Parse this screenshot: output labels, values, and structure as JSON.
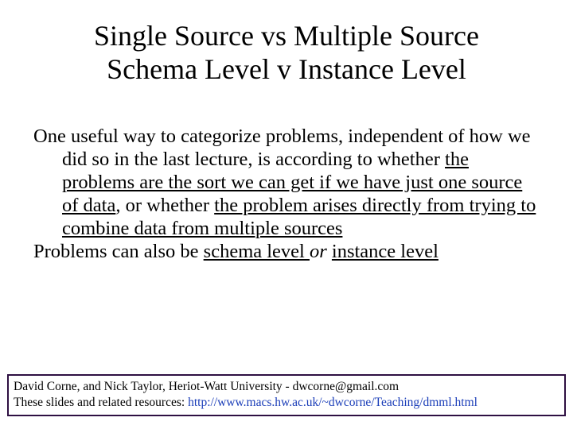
{
  "title": {
    "line1": "Single Source vs Multiple Source",
    "line2": "Schema Level v Instance Level"
  },
  "body": {
    "p1_a": "One useful way to categorize problems, independent of how we did so in the last lecture, is according to whether ",
    "p1_u1": "the problems are the sort we can get if we have just one source of data",
    "p1_b": ", or whether ",
    "p1_u2": "the problem arises directly from trying to combine data from multiple sources",
    "p2_a": "Problems can also be ",
    "p2_u1": "schema level ",
    "p2_b": " or ",
    "p2_u2": "instance level"
  },
  "footer": {
    "line1": "David Corne, and Nick Taylor,  Heriot-Watt University  -  dwcorne@gmail.com",
    "line2_a": "These slides and related resources:  ",
    "line2_link": "http://www.macs.hw.ac.uk/~dwcorne/Teaching/dmml.html"
  }
}
